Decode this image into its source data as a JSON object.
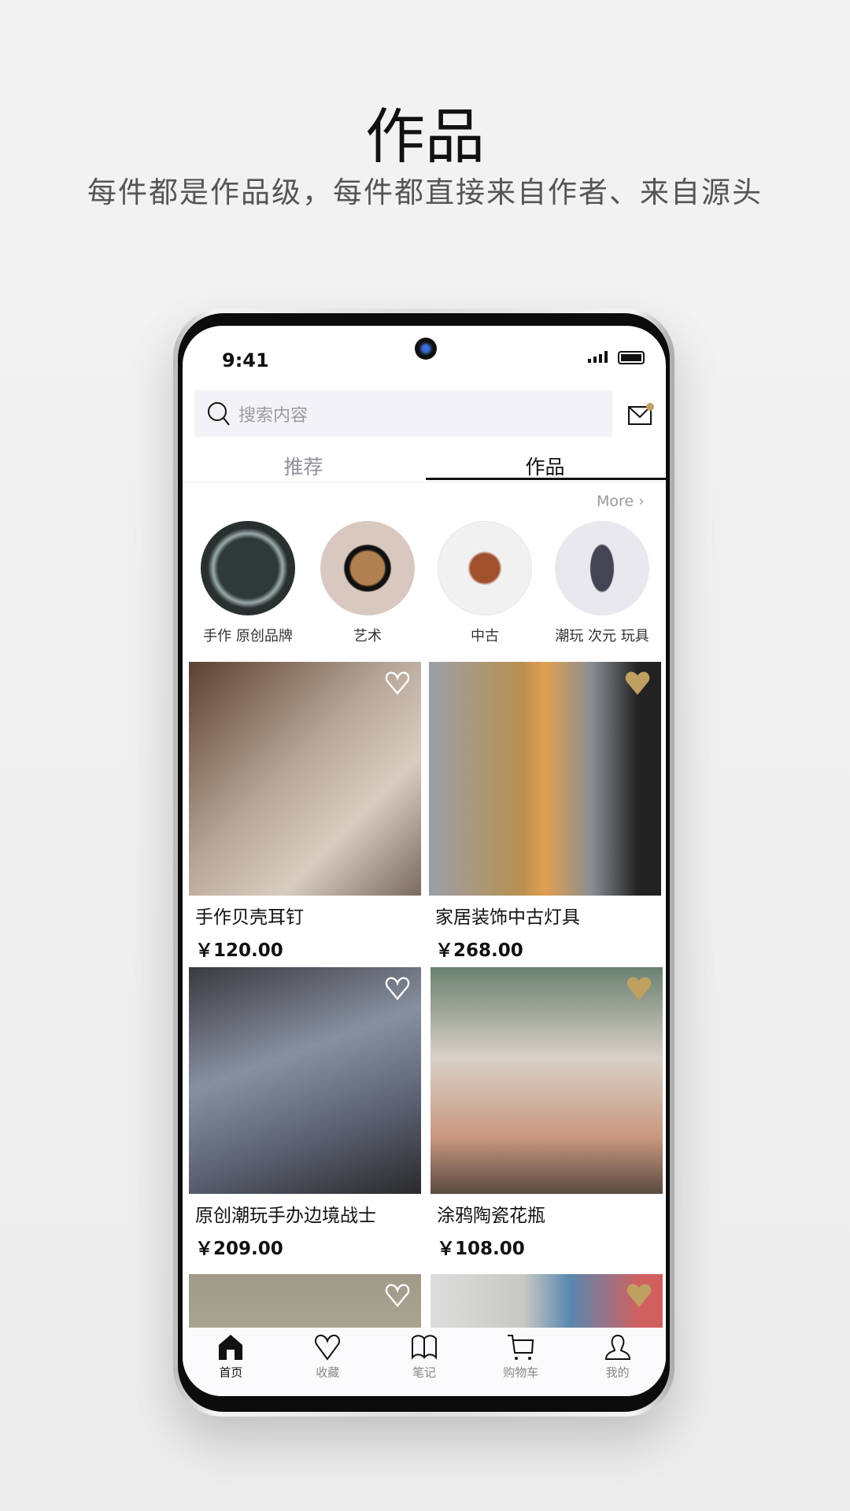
{
  "header": {
    "title": "作品",
    "subtitle": "每件都是作品级，每件都直接来自作者、来自源头"
  },
  "status": {
    "time": "9:41"
  },
  "search": {
    "placeholder": "搜索内容",
    "icon": "search-icon"
  },
  "mail": {
    "icon": "mail-icon",
    "badge_color": "#c0a060"
  },
  "tabs": [
    {
      "label": "推荐"
    },
    {
      "label": "作品",
      "active": true
    }
  ],
  "more": {
    "label": "More"
  },
  "categories": [
    {
      "label": "手作 原创品牌"
    },
    {
      "label": "艺术"
    },
    {
      "label": "中古"
    },
    {
      "label": "潮玩 次元 玩具"
    }
  ],
  "products": [
    {
      "title": "手作贝壳耳钉",
      "price": "￥120.00",
      "favorited": false
    },
    {
      "title": "家居装饰中古灯具",
      "price": "￥268.00",
      "favorited": true
    },
    {
      "title": "原创潮玩手办边境战士",
      "price": "￥209.00",
      "favorited": false
    },
    {
      "title": "涂鸦陶瓷花瓶",
      "price": "￥108.00",
      "favorited": true
    },
    {
      "favorited": false
    },
    {
      "favorited": true
    }
  ],
  "nav": [
    {
      "label": "首页",
      "icon": "home-icon",
      "active": true
    },
    {
      "label": "收藏",
      "icon": "heart-icon"
    },
    {
      "label": "笔记",
      "icon": "book-icon"
    },
    {
      "label": "购物车",
      "icon": "cart-icon"
    },
    {
      "label": "我的",
      "icon": "user-icon"
    }
  ],
  "colors": {
    "accent": "#c0a060",
    "active": "#111111",
    "inactive": "#888888"
  }
}
